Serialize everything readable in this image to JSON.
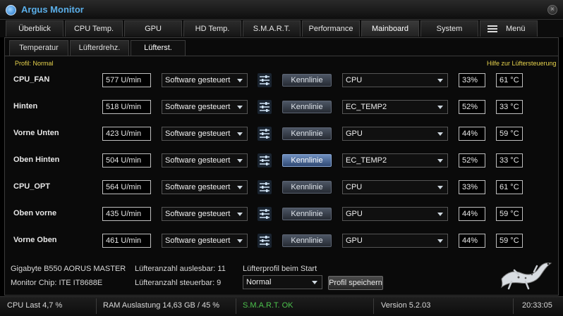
{
  "app": {
    "title": "Argus Monitor",
    "close_glyph": "×"
  },
  "tabs": [
    "Überblick",
    "CPU Temp.",
    "GPU",
    "HD Temp.",
    "S.M.A.R.T.",
    "Performance",
    "Mainboard",
    "System",
    "Menü"
  ],
  "subtabs": [
    "Temperatur",
    "Lüfterdrehz.",
    "Lüfterst."
  ],
  "profile_label": "Profil: Normal",
  "help_link": "Hilfe zur Lüftersteuerung",
  "fans": [
    {
      "name": "CPU_FAN",
      "rpm": "577 U/min",
      "mode": "Software gesteuert",
      "curve": "Kennlinie",
      "source": "CPU",
      "percent": "33%",
      "temp": "61 °C"
    },
    {
      "name": "Hinten",
      "rpm": "518 U/min",
      "mode": "Software gesteuert",
      "curve": "Kennlinie",
      "source": "EC_TEMP2",
      "percent": "52%",
      "temp": "33 °C"
    },
    {
      "name": "Vorne Unten",
      "rpm": "423 U/min",
      "mode": "Software gesteuert",
      "curve": "Kennlinie",
      "source": "GPU",
      "percent": "44%",
      "temp": "59 °C"
    },
    {
      "name": "Oben Hinten",
      "rpm": "504 U/min",
      "mode": "Software gesteuert",
      "curve": "Kennlinie",
      "source": "EC_TEMP2",
      "percent": "52%",
      "temp": "33 °C"
    },
    {
      "name": "CPU_OPT",
      "rpm": "564 U/min",
      "mode": "Software gesteuert",
      "curve": "Kennlinie",
      "source": "CPU",
      "percent": "33%",
      "temp": "61 °C"
    },
    {
      "name": "Oben vorne",
      "rpm": "435 U/min",
      "mode": "Software gesteuert",
      "curve": "Kennlinie",
      "source": "GPU",
      "percent": "44%",
      "temp": "59 °C"
    },
    {
      "name": "Vorne Oben",
      "rpm": "461 U/min",
      "mode": "Software gesteuert",
      "curve": "Kennlinie",
      "source": "GPU",
      "percent": "44%",
      "temp": "59 °C"
    }
  ],
  "footer": {
    "board": "Gigabyte B550 AORUS MASTER",
    "chip": "Monitor Chip: ITE IT8688E",
    "readable": "Lüfteranzahl auslesbar: 11",
    "controllable": "Lüfteranzahl steuerbar: 9",
    "start_profile_label": "Lüfterprofil beim Start",
    "start_profile_value": "Normal",
    "save_button": "Profil speichern"
  },
  "status": {
    "cpu": "CPU Last 4,7 %",
    "ram": "RAM Auslastung 14,63 GB / 45 %",
    "smart": "S.M.A.R.T. OK",
    "version": "Version 5.2.03",
    "time": "20:33:05"
  },
  "colors": {
    "accent_yellow": "#e8d44d",
    "smart_ok": "#4cc24c",
    "title_blue": "#5aaee8"
  },
  "icons": [
    "app-logo-icon",
    "close-icon",
    "menu-icon",
    "fan-curve-settings-icon",
    "chevron-down-icon",
    "lizard-logo"
  ]
}
